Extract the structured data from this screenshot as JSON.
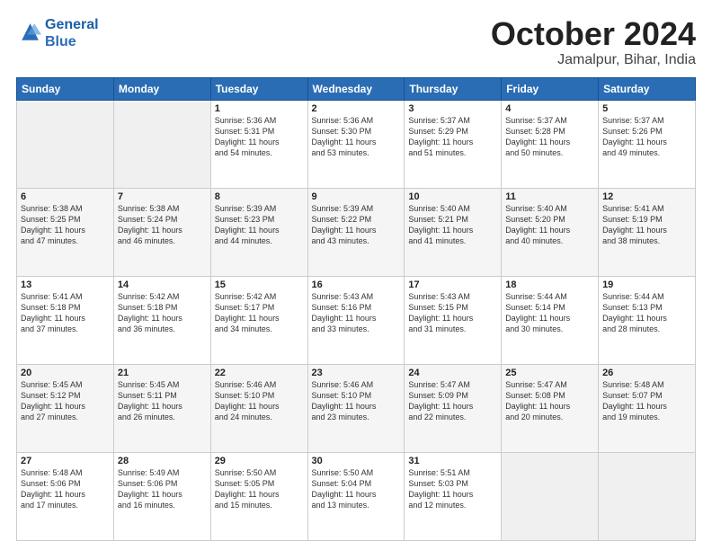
{
  "logo": {
    "line1": "General",
    "line2": "Blue"
  },
  "header": {
    "month": "October 2024",
    "location": "Jamalpur, Bihar, India"
  },
  "weekdays": [
    "Sunday",
    "Monday",
    "Tuesday",
    "Wednesday",
    "Thursday",
    "Friday",
    "Saturday"
  ],
  "rows": [
    [
      {
        "day": "",
        "info": ""
      },
      {
        "day": "",
        "info": ""
      },
      {
        "day": "1",
        "info": "Sunrise: 5:36 AM\nSunset: 5:31 PM\nDaylight: 11 hours\nand 54 minutes."
      },
      {
        "day": "2",
        "info": "Sunrise: 5:36 AM\nSunset: 5:30 PM\nDaylight: 11 hours\nand 53 minutes."
      },
      {
        "day": "3",
        "info": "Sunrise: 5:37 AM\nSunset: 5:29 PM\nDaylight: 11 hours\nand 51 minutes."
      },
      {
        "day": "4",
        "info": "Sunrise: 5:37 AM\nSunset: 5:28 PM\nDaylight: 11 hours\nand 50 minutes."
      },
      {
        "day": "5",
        "info": "Sunrise: 5:37 AM\nSunset: 5:26 PM\nDaylight: 11 hours\nand 49 minutes."
      }
    ],
    [
      {
        "day": "6",
        "info": "Sunrise: 5:38 AM\nSunset: 5:25 PM\nDaylight: 11 hours\nand 47 minutes."
      },
      {
        "day": "7",
        "info": "Sunrise: 5:38 AM\nSunset: 5:24 PM\nDaylight: 11 hours\nand 46 minutes."
      },
      {
        "day": "8",
        "info": "Sunrise: 5:39 AM\nSunset: 5:23 PM\nDaylight: 11 hours\nand 44 minutes."
      },
      {
        "day": "9",
        "info": "Sunrise: 5:39 AM\nSunset: 5:22 PM\nDaylight: 11 hours\nand 43 minutes."
      },
      {
        "day": "10",
        "info": "Sunrise: 5:40 AM\nSunset: 5:21 PM\nDaylight: 11 hours\nand 41 minutes."
      },
      {
        "day": "11",
        "info": "Sunrise: 5:40 AM\nSunset: 5:20 PM\nDaylight: 11 hours\nand 40 minutes."
      },
      {
        "day": "12",
        "info": "Sunrise: 5:41 AM\nSunset: 5:19 PM\nDaylight: 11 hours\nand 38 minutes."
      }
    ],
    [
      {
        "day": "13",
        "info": "Sunrise: 5:41 AM\nSunset: 5:18 PM\nDaylight: 11 hours\nand 37 minutes."
      },
      {
        "day": "14",
        "info": "Sunrise: 5:42 AM\nSunset: 5:18 PM\nDaylight: 11 hours\nand 36 minutes."
      },
      {
        "day": "15",
        "info": "Sunrise: 5:42 AM\nSunset: 5:17 PM\nDaylight: 11 hours\nand 34 minutes."
      },
      {
        "day": "16",
        "info": "Sunrise: 5:43 AM\nSunset: 5:16 PM\nDaylight: 11 hours\nand 33 minutes."
      },
      {
        "day": "17",
        "info": "Sunrise: 5:43 AM\nSunset: 5:15 PM\nDaylight: 11 hours\nand 31 minutes."
      },
      {
        "day": "18",
        "info": "Sunrise: 5:44 AM\nSunset: 5:14 PM\nDaylight: 11 hours\nand 30 minutes."
      },
      {
        "day": "19",
        "info": "Sunrise: 5:44 AM\nSunset: 5:13 PM\nDaylight: 11 hours\nand 28 minutes."
      }
    ],
    [
      {
        "day": "20",
        "info": "Sunrise: 5:45 AM\nSunset: 5:12 PM\nDaylight: 11 hours\nand 27 minutes."
      },
      {
        "day": "21",
        "info": "Sunrise: 5:45 AM\nSunset: 5:11 PM\nDaylight: 11 hours\nand 26 minutes."
      },
      {
        "day": "22",
        "info": "Sunrise: 5:46 AM\nSunset: 5:10 PM\nDaylight: 11 hours\nand 24 minutes."
      },
      {
        "day": "23",
        "info": "Sunrise: 5:46 AM\nSunset: 5:10 PM\nDaylight: 11 hours\nand 23 minutes."
      },
      {
        "day": "24",
        "info": "Sunrise: 5:47 AM\nSunset: 5:09 PM\nDaylight: 11 hours\nand 22 minutes."
      },
      {
        "day": "25",
        "info": "Sunrise: 5:47 AM\nSunset: 5:08 PM\nDaylight: 11 hours\nand 20 minutes."
      },
      {
        "day": "26",
        "info": "Sunrise: 5:48 AM\nSunset: 5:07 PM\nDaylight: 11 hours\nand 19 minutes."
      }
    ],
    [
      {
        "day": "27",
        "info": "Sunrise: 5:48 AM\nSunset: 5:06 PM\nDaylight: 11 hours\nand 17 minutes."
      },
      {
        "day": "28",
        "info": "Sunrise: 5:49 AM\nSunset: 5:06 PM\nDaylight: 11 hours\nand 16 minutes."
      },
      {
        "day": "29",
        "info": "Sunrise: 5:50 AM\nSunset: 5:05 PM\nDaylight: 11 hours\nand 15 minutes."
      },
      {
        "day": "30",
        "info": "Sunrise: 5:50 AM\nSunset: 5:04 PM\nDaylight: 11 hours\nand 13 minutes."
      },
      {
        "day": "31",
        "info": "Sunrise: 5:51 AM\nSunset: 5:03 PM\nDaylight: 11 hours\nand 12 minutes."
      },
      {
        "day": "",
        "info": ""
      },
      {
        "day": "",
        "info": ""
      }
    ]
  ]
}
